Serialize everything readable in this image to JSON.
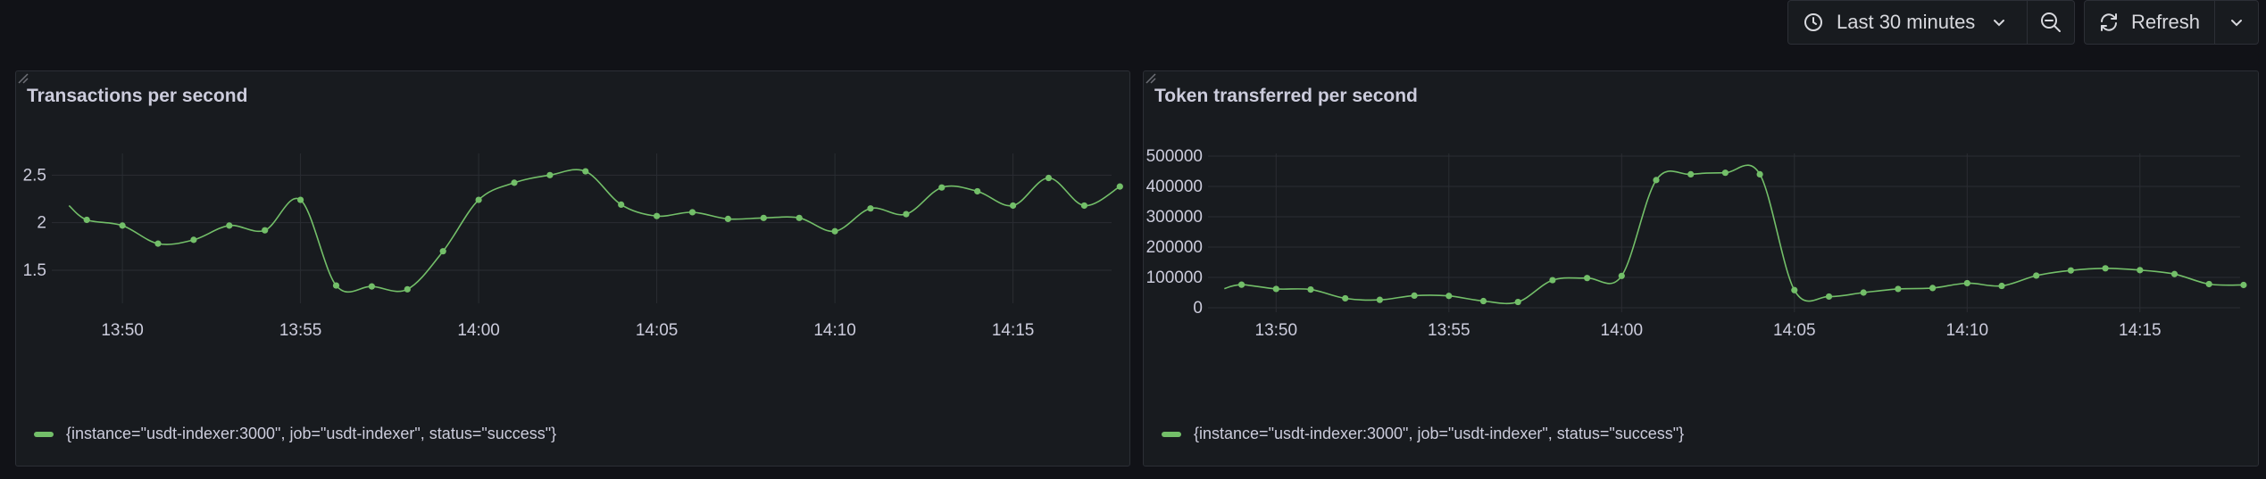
{
  "toolbar": {
    "time_range_label": "Last 30 minutes",
    "refresh_label": "Refresh",
    "icons": {
      "time": "clock-icon",
      "time_dropdown": "chevron-down-icon",
      "zoom_out": "zoom-out-icon",
      "refresh": "refresh-icon",
      "refresh_dropdown": "chevron-down-icon"
    }
  },
  "colors": {
    "series": "#73bf69",
    "grid": "#2a2d33",
    "background": "#111217",
    "panel": "#181b1f"
  },
  "panels": [
    {
      "title": "Transactions per second",
      "legend": "{instance=\"usdt-indexer:3000\", job=\"usdt-indexer\", status=\"success\"}"
    },
    {
      "title": "Token transferred per second",
      "legend": "{instance=\"usdt-indexer:3000\", job=\"usdt-indexer\", status=\"success\"}"
    }
  ],
  "chart_data": [
    {
      "type": "line",
      "title": "Transactions per second",
      "xlabel": "",
      "ylabel": "",
      "x_ticks": [
        "13:50",
        "13:55",
        "14:00",
        "14:05",
        "14:10",
        "14:15"
      ],
      "y_ticks": [
        "1.5",
        "2",
        "2.5"
      ],
      "ylim": [
        1.2,
        2.7
      ],
      "grid": true,
      "legend_position": "bottom-left",
      "series": [
        {
          "name": "{instance=\"usdt-indexer:3000\", job=\"usdt-indexer\", status=\"success\"}",
          "x": [
            "13:48:30",
            "13:49:00",
            "13:50:00",
            "13:51:00",
            "13:52:00",
            "13:53:00",
            "13:54:00",
            "13:55:00",
            "13:56:00",
            "13:57:00",
            "13:58:00",
            "13:59:00",
            "14:00:00",
            "14:01:00",
            "14:02:00",
            "14:03:00",
            "14:04:00",
            "14:05:00",
            "14:06:00",
            "14:07:00",
            "14:08:00",
            "14:09:00",
            "14:10:00",
            "14:11:00",
            "14:12:00",
            "14:13:00",
            "14:14:00",
            "14:15:00",
            "14:16:00",
            "14:17:00",
            "14:18:00"
          ],
          "y": [
            2.18,
            2.03,
            1.97,
            1.78,
            1.82,
            1.97,
            1.92,
            2.24,
            1.34,
            1.33,
            1.3,
            1.7,
            2.24,
            2.42,
            2.5,
            2.54,
            2.19,
            2.07,
            2.11,
            2.04,
            2.05,
            2.05,
            1.91,
            2.15,
            2.09,
            2.37,
            2.33,
            2.18,
            2.47,
            2.18,
            2.38
          ]
        }
      ]
    },
    {
      "type": "line",
      "title": "Token transferred per second",
      "xlabel": "",
      "ylabel": "",
      "x_ticks": [
        "13:50",
        "13:55",
        "14:00",
        "14:05",
        "14:10",
        "14:15"
      ],
      "y_ticks": [
        "0",
        "100000",
        "200000",
        "300000",
        "400000",
        "500000"
      ],
      "ylim": [
        0,
        500000
      ],
      "grid": true,
      "legend_position": "bottom-left",
      "series": [
        {
          "name": "{instance=\"usdt-indexer:3000\", job=\"usdt-indexer\", status=\"success\"}",
          "x": [
            "13:48:30",
            "13:49:00",
            "13:50:00",
            "13:51:00",
            "13:52:00",
            "13:53:00",
            "13:54:00",
            "13:55:00",
            "13:56:00",
            "13:57:00",
            "13:58:00",
            "13:59:00",
            "14:00:00",
            "14:01:00",
            "14:02:00",
            "14:03:00",
            "14:04:00",
            "14:05:00",
            "14:06:00",
            "14:07:00",
            "14:08:00",
            "14:09:00",
            "14:10:00",
            "14:11:00",
            "14:12:00",
            "14:13:00",
            "14:14:00",
            "14:15:00",
            "14:16:00",
            "14:17:00",
            "14:18:00"
          ],
          "y": [
            63000,
            76000,
            62000,
            60000,
            31000,
            26000,
            40000,
            39000,
            22000,
            19000,
            91000,
            98000,
            105000,
            421000,
            440000,
            445000,
            440000,
            58000,
            37000,
            50000,
            62000,
            65000,
            81000,
            72000,
            106000,
            123000,
            130000,
            124000,
            111000,
            78000,
            75000
          ]
        }
      ]
    }
  ]
}
